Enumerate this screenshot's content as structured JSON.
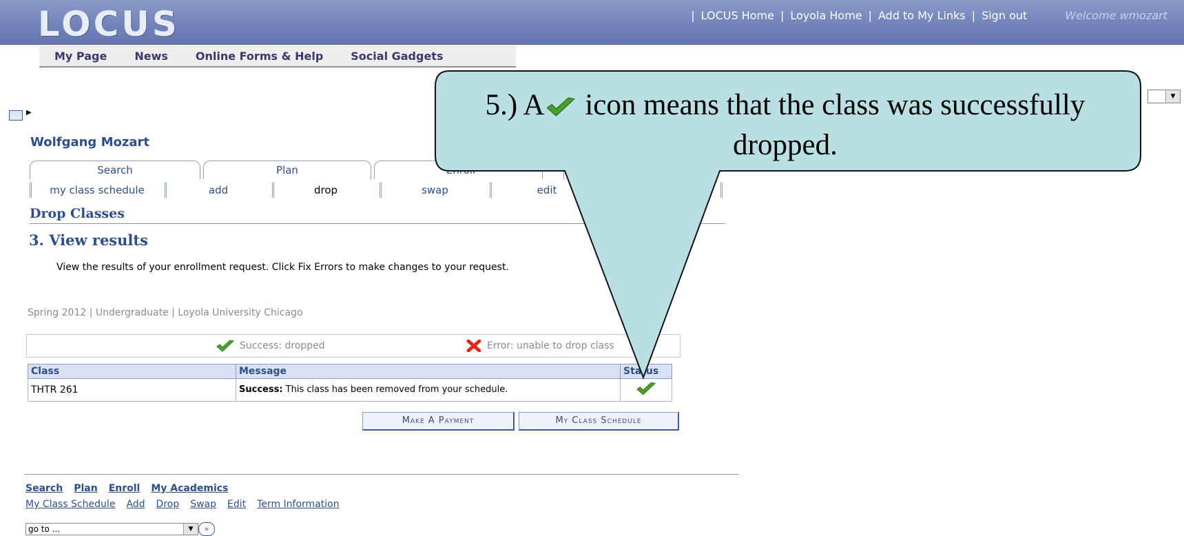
{
  "header": {
    "logo": "LOCUS",
    "links": [
      "LOCUS Home",
      "Loyola Home",
      "Add to My Links",
      "Sign out"
    ],
    "welcome": "Welcome wmozart"
  },
  "nav": {
    "items": [
      "My Page",
      "News",
      "Online Forms & Help",
      "Social Gadgets"
    ]
  },
  "student_name": "Wolfgang Mozart",
  "tabs": [
    "Search",
    "Plan",
    "Enroll"
  ],
  "subtabs": [
    "my class schedule",
    "add",
    "drop",
    "swap",
    "edit"
  ],
  "section_title": "Drop Classes",
  "step_title": "3.  View results",
  "instructions": "View the results of your enrollment request.  Click Fix Errors to make changes to your request.",
  "term_line": "Spring 2012 | Undergraduate | Loyola University Chicago",
  "legend": {
    "success": "Success: dropped",
    "error": "Error: unable to drop class"
  },
  "table": {
    "headers": [
      "Class",
      "Message",
      "Status"
    ],
    "rows": [
      {
        "class": "THTR  261",
        "message_bold": "Success:",
        "message": " This class has been removed from your schedule."
      }
    ]
  },
  "buttons": {
    "payment": "Make A Payment",
    "schedule": "My Class Schedule"
  },
  "footer": {
    "row1": [
      "Search",
      "Plan",
      "Enroll",
      "My Academics"
    ],
    "row2": [
      "My Class Schedule",
      "Add",
      "Drop",
      "Swap",
      "Edit",
      "Term Information"
    ],
    "goto": "go to ..."
  },
  "callout": {
    "prefix": "5.) A",
    "suffix": " icon means that the class was successfully dropped."
  },
  "colors": {
    "header": "#6f82b9",
    "link": "#2d4e89",
    "callout_fill": "#b9dfe3",
    "success": "#4aa02c",
    "error": "#e0281a"
  }
}
